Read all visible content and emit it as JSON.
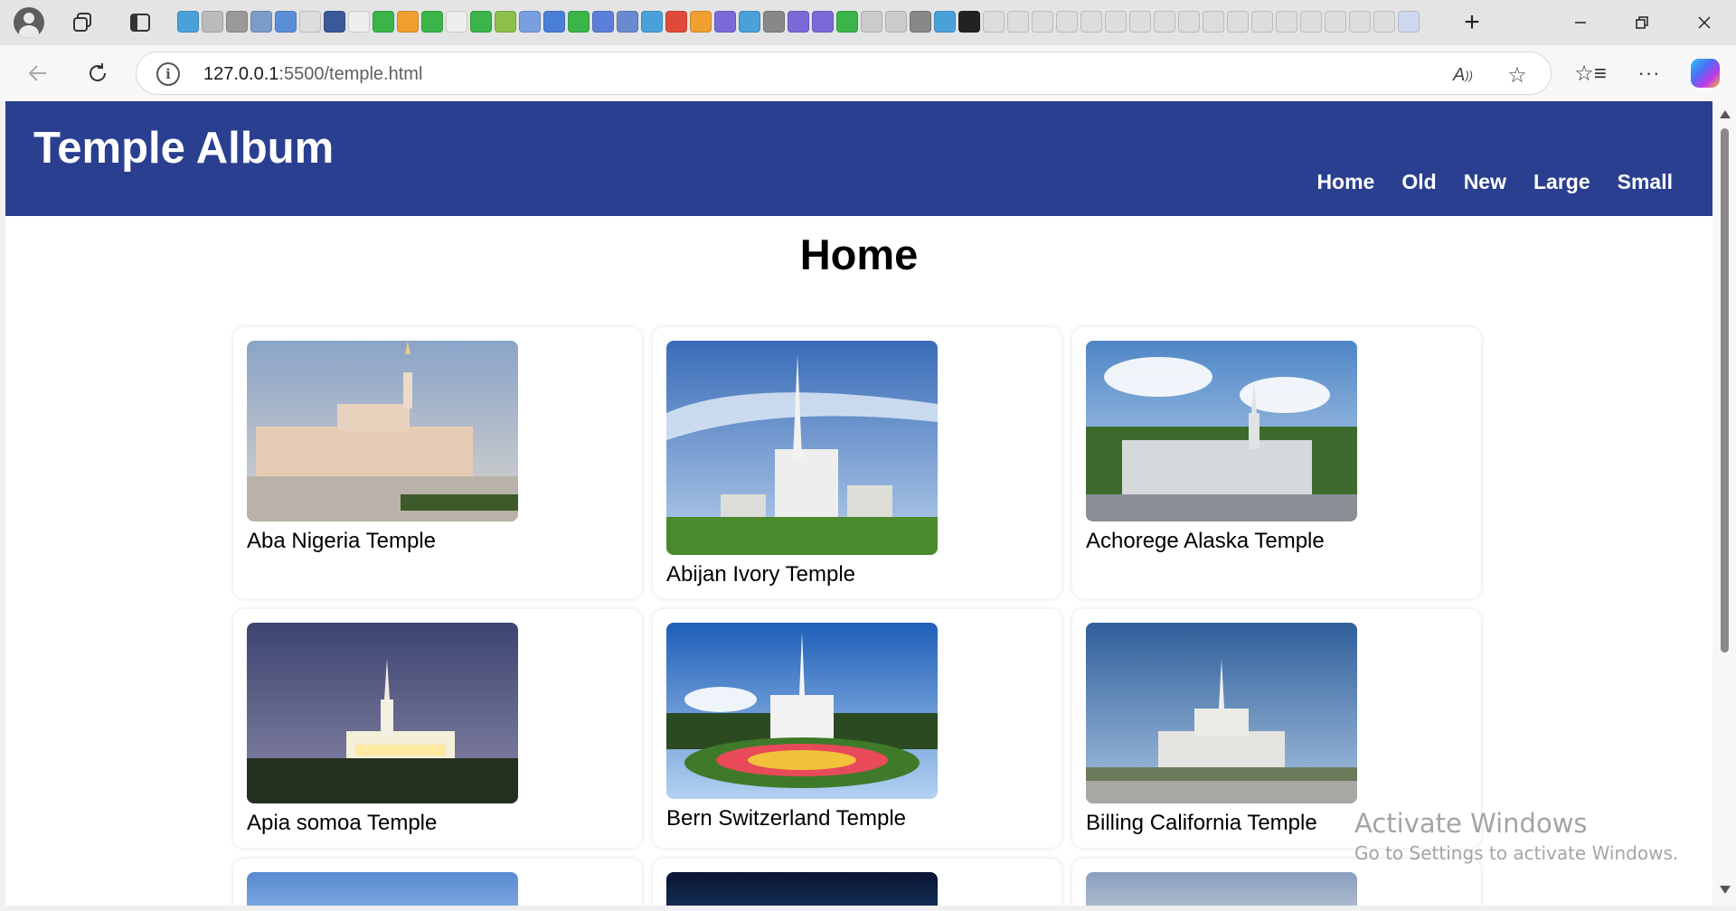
{
  "browser": {
    "url_host": "127.0.0.1",
    "url_path": ":5500/temple.html",
    "read_aloud_icon": "read-aloud-icon",
    "favorite_icon": "star-icon",
    "more_label": "···"
  },
  "header": {
    "title": "Temple Album",
    "nav": [
      "Home",
      "Old",
      "New",
      "Large",
      "Small"
    ]
  },
  "main": {
    "heading": "Home",
    "temples": [
      {
        "name": "Aba Nigeria Temple"
      },
      {
        "name": "Abijan Ivory Temple"
      },
      {
        "name": "Achorege Alaska Temple"
      },
      {
        "name": "Apia somoa Temple"
      },
      {
        "name": "Bern Switzerland Temple"
      },
      {
        "name": "Billing California Temple"
      }
    ]
  },
  "watermark": {
    "line1": "Activate Windows",
    "line2": "Go to Settings to activate Windows."
  },
  "colors": {
    "header_bg": "#2a3f8f",
    "header_text": "#ffffff"
  }
}
